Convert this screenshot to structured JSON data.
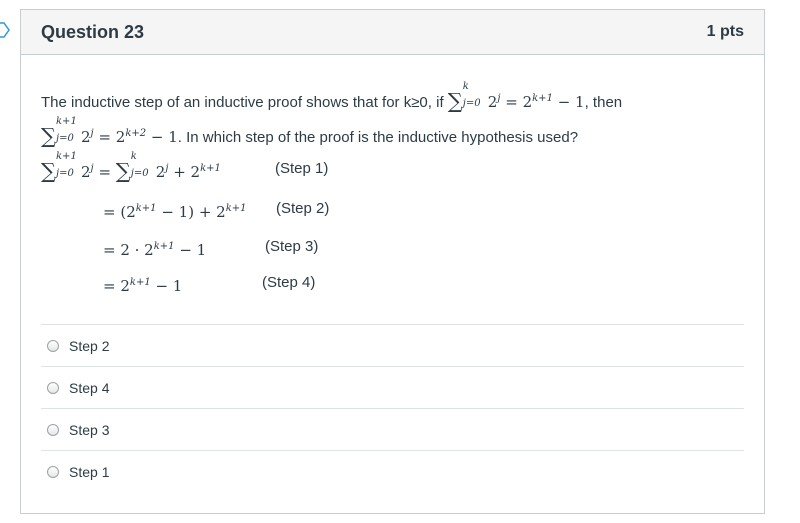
{
  "question": {
    "title": "Question 23",
    "points": "1 pts",
    "text_part1": "The inductive step of an inductive proof shows that for k≥0, if",
    "text_part2": ", then",
    "text_part3": ". In which step of the proof is the inductive hypothesis used?"
  },
  "math": {
    "sum_upper_k": "k",
    "sum_upper_k1": "k+1",
    "sum_lower": "j=0",
    "eq1": "2",
    "eq1_exp": "j",
    "eq1_rhs": "= 2",
    "eq1_rhs_exp": "k+1",
    "eq1_tail": " − 1",
    "eq2_rhs_exp": "k+2",
    "step1_expr": "= ",
    "step1_tail": " + 2",
    "step2_expr": "= (2",
    "step2_tail": " − 1) + 2",
    "step3_expr": "= 2 · 2",
    "step3_tail": " − 1",
    "step4_expr": "= 2",
    "step4_tail": " − 1"
  },
  "steps": {
    "labels": [
      "(Step 1)",
      "(Step 2)",
      "(Step 3)",
      "(Step 4)"
    ]
  },
  "answers": [
    "Step 2",
    "Step 4",
    "Step 3",
    "Step 1"
  ]
}
